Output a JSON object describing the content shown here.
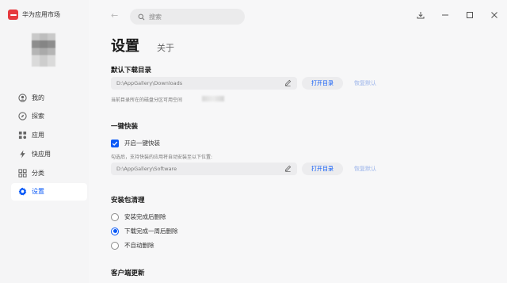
{
  "app": {
    "name": "华为应用市场"
  },
  "sidebar": {
    "items": [
      {
        "label": "我的",
        "icon": "person-icon",
        "active": false
      },
      {
        "label": "探索",
        "icon": "compass-icon",
        "active": false
      },
      {
        "label": "应用",
        "icon": "apps-grid-icon",
        "active": false
      },
      {
        "label": "快应用",
        "icon": "lightning-icon",
        "active": false
      },
      {
        "label": "分类",
        "icon": "category-grid-icon",
        "active": false
      },
      {
        "label": "设置",
        "icon": "gear-icon",
        "active": true
      }
    ]
  },
  "header": {
    "search_placeholder": "搜索"
  },
  "page": {
    "title": "设置",
    "about_tab": "关于"
  },
  "download_dir": {
    "title": "默认下载目录",
    "path": "D:\\AppGallery\\Downloads",
    "open_label": "打开目录",
    "restore_label": "恢复默认",
    "hint": "当前目录所在的磁盘分区可用空间"
  },
  "quick_install": {
    "title": "一键快装",
    "checkbox_label": "开启一键快装",
    "checked": true,
    "hint": "勾选后，支持快装的应用将自动安装至以下位置:",
    "path": "D:\\AppGallery\\Software",
    "open_label": "打开目录",
    "restore_label": "恢复默认"
  },
  "package_cleanup": {
    "title": "安装包清理",
    "options": [
      {
        "label": "安装完成后删除",
        "selected": false
      },
      {
        "label": "下载完成一周后删除",
        "selected": true
      },
      {
        "label": "不自动删除",
        "selected": false
      }
    ]
  },
  "client_update": {
    "title": "客户端更新"
  },
  "colors": {
    "accent": "#0a59f7",
    "brand": "#e63a3f"
  }
}
